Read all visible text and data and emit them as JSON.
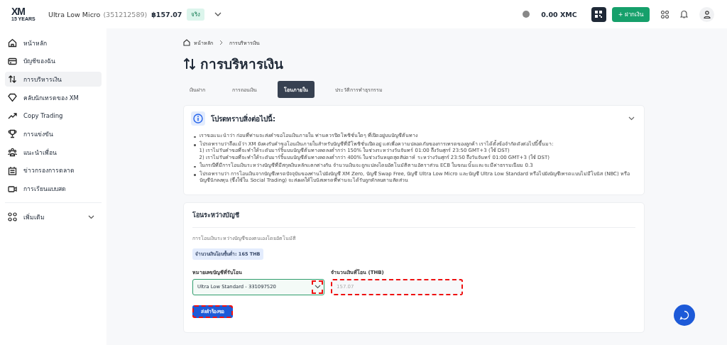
{
  "header": {
    "logo": {
      "mark": "XM",
      "tagline": "15 YEARS"
    },
    "account_name": "Ultra Low Micro",
    "account_number": "(351212589)",
    "balance": "฿157.07",
    "badge": "จริง",
    "coins": "0.00 XMC",
    "deposit_button": "+ ฝากเงิน"
  },
  "sidebar": {
    "items": [
      {
        "label": "หน้าหลัก",
        "selected": false
      },
      {
        "label": "บัญชีของฉัน",
        "selected": false
      },
      {
        "label": "การบริหารเงิน",
        "selected": true
      },
      {
        "label": "คลับนักเทรดของ XM",
        "selected": false
      },
      {
        "label": "Copy Trading",
        "selected": false
      },
      {
        "label": "การแข่งขัน",
        "selected": false
      },
      {
        "label": "แนะนำเพื่อน",
        "selected": false
      },
      {
        "label": "ข่าวกรองการตลาด",
        "selected": false
      },
      {
        "label": "การเรียนแบบสด",
        "selected": false
      }
    ],
    "more": {
      "label": "เพิ่มเติม",
      "expanded": false
    }
  },
  "breadcrumb": [
    "หน้าหลัก",
    "การบริหารเงิน"
  ],
  "title": "การบริหารเงิน",
  "tabs": [
    {
      "label": "เงินฝาก",
      "selected": false
    },
    {
      "label": "การถอนเงิน",
      "selected": false
    },
    {
      "label": "โอนภายใน",
      "selected": true
    },
    {
      "label": "ประวัติการทำธุรกรรม",
      "selected": false
    }
  ],
  "notice": {
    "title": "โปรดทราบสิ่งต่อไปนี้:",
    "expanded": true,
    "items": [
      {
        "text": "เราขอแนะนำว่า ก่อนที่ท่านจะส่งคำขอโอนเงินภายใน ท่านควรปิดโพซิชั่นใดๆ ที่เปิดอยู่บนบัญชีต้นทาง"
      },
      {
        "text": "โปรดทราบว่าถึงแม้ว่า XM ยังคงรับคำขอโอนเงินภายในสำหรับบัญชีที่มีโพซิชั่นเปิดอยู่ แต่เพื่อความปลอดภัยของการเทรดของลูกค้า เราได้ตั้งข้อจำกัดดังต่อไปนี้ขึ้นมา:",
        "sublines": [
          "1) เราไม่รับคำขอที่จะทำให้ระดับมาร์จิ้นบนบัญชีต้นทางลดลงต่ำกว่า 150% ในช่วงระหว่างวันจันทร์ 01:00 ถึงวันศุกร์ 23:50 GMT+3 (ใช้ DST)",
          "2) เราไม่รับคำขอที่จะทำให้ระดับมาร์จิ้นบนบัญชีต้นทางลดลงต่ำกว่า 400% ในช่วงวันหยุดสุดสัปดาห์ ระหว่างวันศุกร์ 23:50 ถึงวันจันทร์ 01:00 GMT+3 (ใช้ DST)"
        ]
      },
      {
        "text": "ในกรณีที่มีการโอนเงินระหว่างบัญชีที่มีสกุลเงินหลักแตกต่างกัน จำนวนเงินจะถูกแปลงโดยอัตโนมัติตามอัตราส่วน ECB ในขณะนั้นและจะมีค่าธรรมเนียม 0.3"
      },
      {
        "text": "โปรดทราบว่า การโอนเงินจากบัญชีเทรดปัจจุบันของท่านไปยังบัญชี XM Zero, บัญชี Swap Free, บัญชี Ultra Low Micro และบัญชี Ultra Low Standard หรือไปยังบัญชีเทรดแบบไม่มีโบนัส (NBC) หรือบัญชีนักลงทุน (ซึ่งใช้ใน Social Trading) จะส่งผลให้โบนัสเทรดที่ท่านจะได้รับถูกหักลบตามสัดส่วน"
      }
    ]
  },
  "transfer": {
    "title": "โอนระหว่างบัญชี",
    "description": "การโอนเงินระหว่างบัญชีของตนเองโดยอัตโนมัติ",
    "minimum": "จำนวนเงินโอนขั้นต่ำ: 165 THB",
    "account_field": {
      "label": "หมายเลขบัญชีที่รับโอน",
      "value": "Ultra Low Standard - 331097520",
      "arrow_highlighted": true
    },
    "amount_field": {
      "label": "จำนวนเงินที่โอน (THB)",
      "placeholder": "157.07",
      "highlighted": true
    },
    "submit": {
      "label": "ส่งคำร้องขอ",
      "highlighted": true
    }
  }
}
